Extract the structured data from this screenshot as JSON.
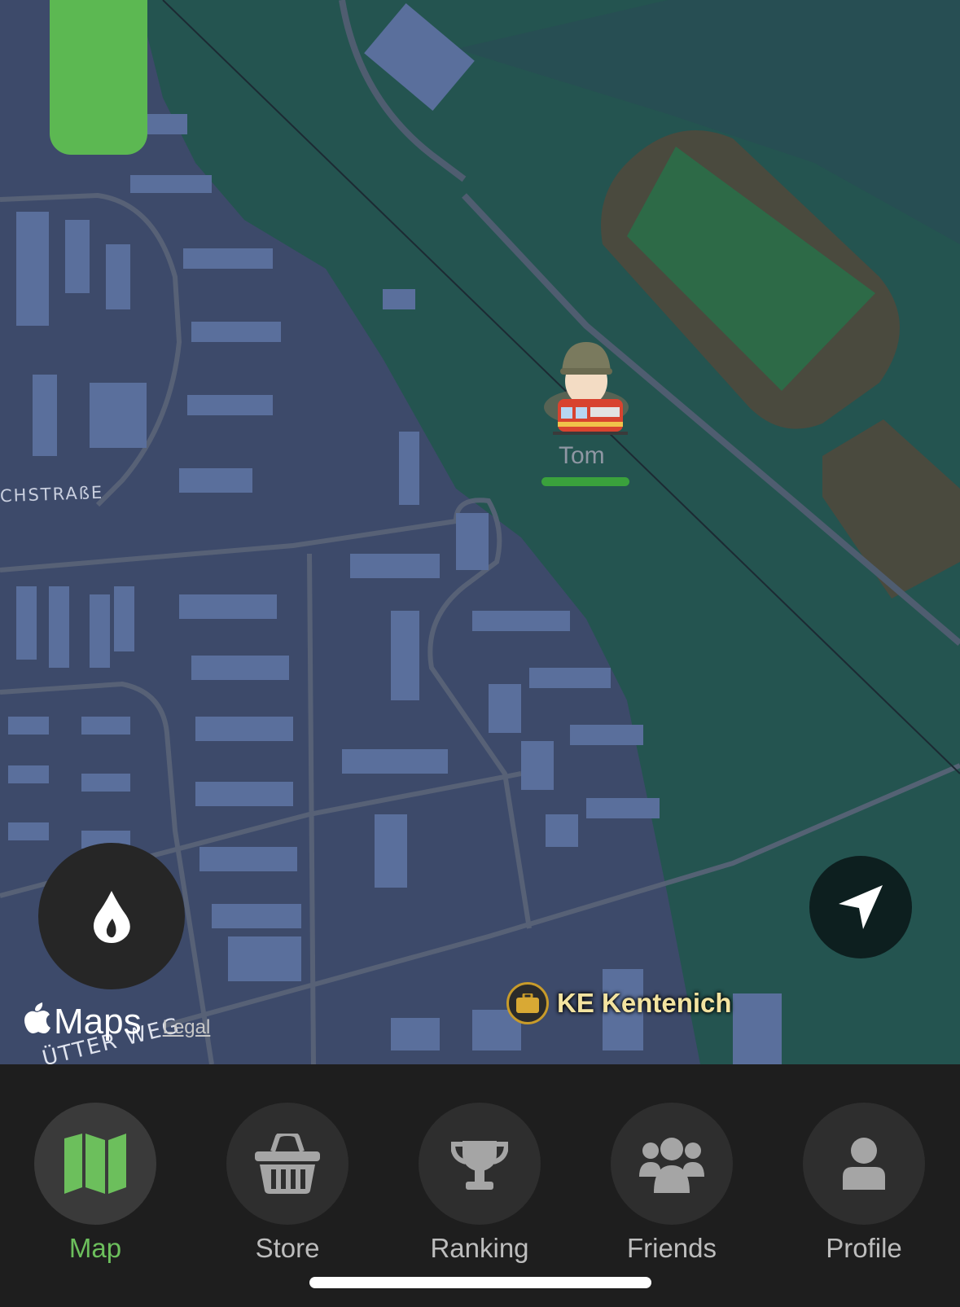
{
  "map": {
    "street_labels": [
      "CHSTRAßE",
      "ÜTTER WEG"
    ],
    "player": {
      "name": "Tom",
      "health_fraction": 1.0
    },
    "poi": {
      "label": "KE Kentenich",
      "icon": "briefcase-icon"
    },
    "attribution": {
      "brand": "Maps",
      "legal": "Legal"
    },
    "energy_level_fraction": 1.0
  },
  "buttons": {
    "fire_icon": "flame-icon",
    "locate_icon": "location-arrow-icon"
  },
  "tabs": [
    {
      "label": "Map",
      "icon": "map-icon",
      "active": true
    },
    {
      "label": "Store",
      "icon": "basket-icon",
      "active": false
    },
    {
      "label": "Ranking",
      "icon": "trophy-icon",
      "active": false
    },
    {
      "label": "Friends",
      "icon": "friends-icon",
      "active": false
    },
    {
      "label": "Profile",
      "icon": "person-icon",
      "active": false
    }
  ],
  "colors": {
    "accent": "#6cbf5c",
    "tab_bar": "#1e1e1e",
    "map_land": "#3d4a6a",
    "map_green": "#245450"
  }
}
